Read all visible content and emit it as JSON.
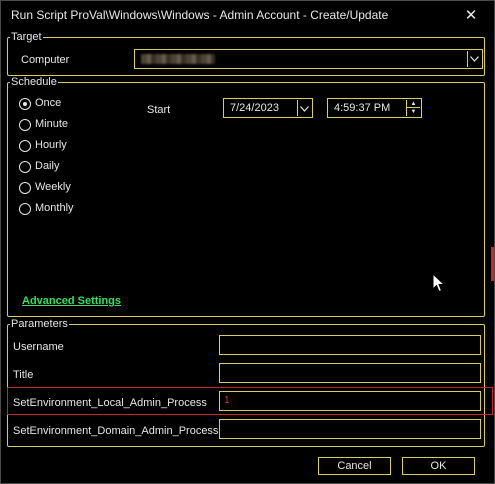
{
  "window": {
    "title": "Run Script ProVal\\Windows\\Windows - Admin Account - Create/Update",
    "close_glyph": "✕"
  },
  "target": {
    "legend": "Target",
    "computer_label": "Computer"
  },
  "schedule": {
    "legend": "Schedule",
    "options": [
      {
        "label": "Once",
        "checked": true
      },
      {
        "label": "Minute",
        "checked": false
      },
      {
        "label": "Hourly",
        "checked": false
      },
      {
        "label": "Daily",
        "checked": false
      },
      {
        "label": "Weekly",
        "checked": false
      },
      {
        "label": "Monthly",
        "checked": false
      }
    ],
    "start_label": "Start",
    "start_date": "7/24/2023",
    "start_time": "4:59:37 PM",
    "advanced_link": "Advanced Settings"
  },
  "parameters": {
    "legend": "Parameters",
    "fields": [
      {
        "label": "Username",
        "value": ""
      },
      {
        "label": "Title",
        "value": ""
      },
      {
        "label": "SetEnvironment_Local_Admin_Process",
        "value": "1"
      },
      {
        "label": "SetEnvironment_Domain_Admin_Process",
        "value": ""
      }
    ]
  },
  "buttons": {
    "cancel": "Cancel",
    "ok": "OK"
  },
  "colors": {
    "background": "#000000",
    "border_accent": "#d9cc5a",
    "link": "#33e060",
    "error": "#c0282d"
  },
  "icons": {
    "dropdown": "chevron-down-icon",
    "close": "close-icon",
    "spinner": "spin-up-down-icon",
    "cursor": "mouse-pointer-icon"
  }
}
